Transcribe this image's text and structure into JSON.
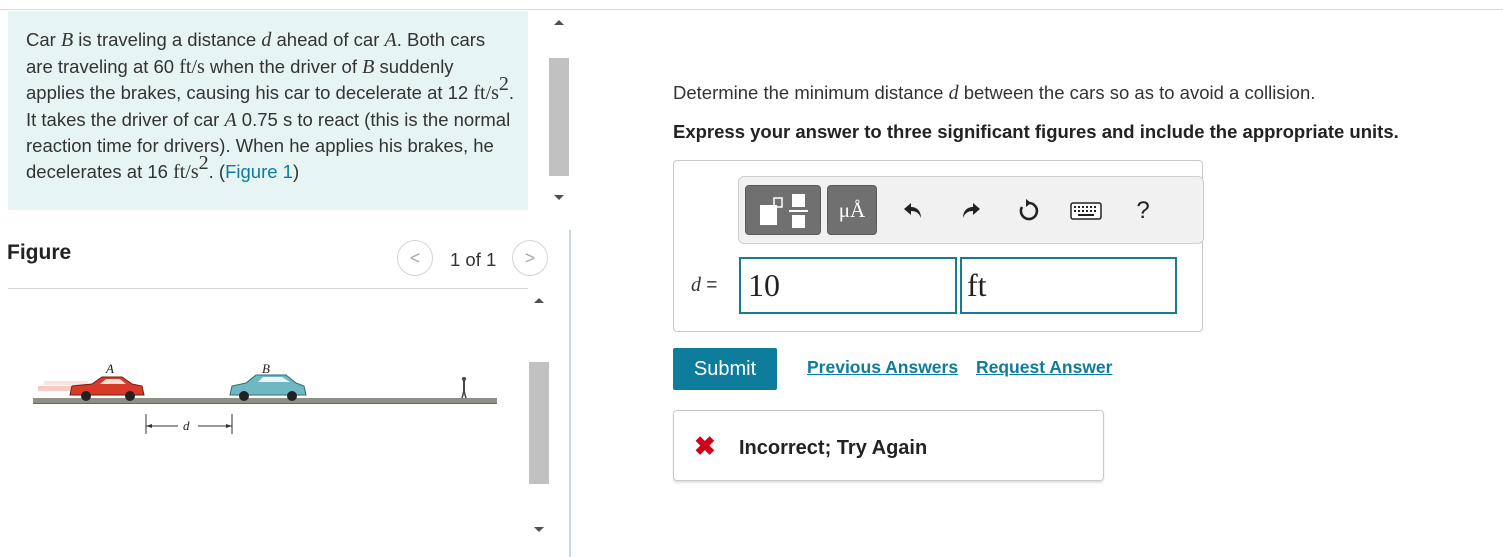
{
  "problem": {
    "segments": [
      "Car ",
      "B",
      " is traveling a distance ",
      "d",
      " ahead of car ",
      "A",
      ". Both cars are traveling at 60 ",
      "ft/s",
      " when the driver of ",
      "B",
      " suddenly applies the brakes, causing his car to decelerate at 12 ",
      "ft/s",
      "2",
      ". It takes the driver of car ",
      "A",
      " 0.75 s to react (this is the normal reaction time for drivers). When he applies his brakes, he decelerates at 16 ",
      "ft/s",
      "2",
      ". (",
      "Figure 1",
      ")"
    ]
  },
  "figure": {
    "label": "Figure",
    "page_count": "1 of 1",
    "prev_glyph": "<",
    "next_glyph": ">",
    "car_a_label": "A",
    "car_b_label": "B",
    "distance_label": "d",
    "car_a_color": "#d63b2a",
    "car_b_color": "#6fb7c2"
  },
  "question": {
    "prompt_before": "Determine the minimum distance ",
    "prompt_var": "d",
    "prompt_after": " between the cars so as to avoid a collision.",
    "instruction": "Express your answer to three significant figures and include the appropriate units."
  },
  "toolbar": {
    "units_label": "μÅ",
    "help_label": "?"
  },
  "answer": {
    "var_label": "d",
    "equals": "=",
    "value": "10",
    "unit": "ft"
  },
  "actions": {
    "submit": "Submit",
    "previous_answers": "Previous Answers",
    "request_answer": "Request Answer"
  },
  "feedback": {
    "icon": "✖",
    "text": "Incorrect; Try Again"
  },
  "colors": {
    "accent": "#0e7c9b",
    "error": "#d0021b",
    "panel_bg": "#e6f4f3"
  }
}
